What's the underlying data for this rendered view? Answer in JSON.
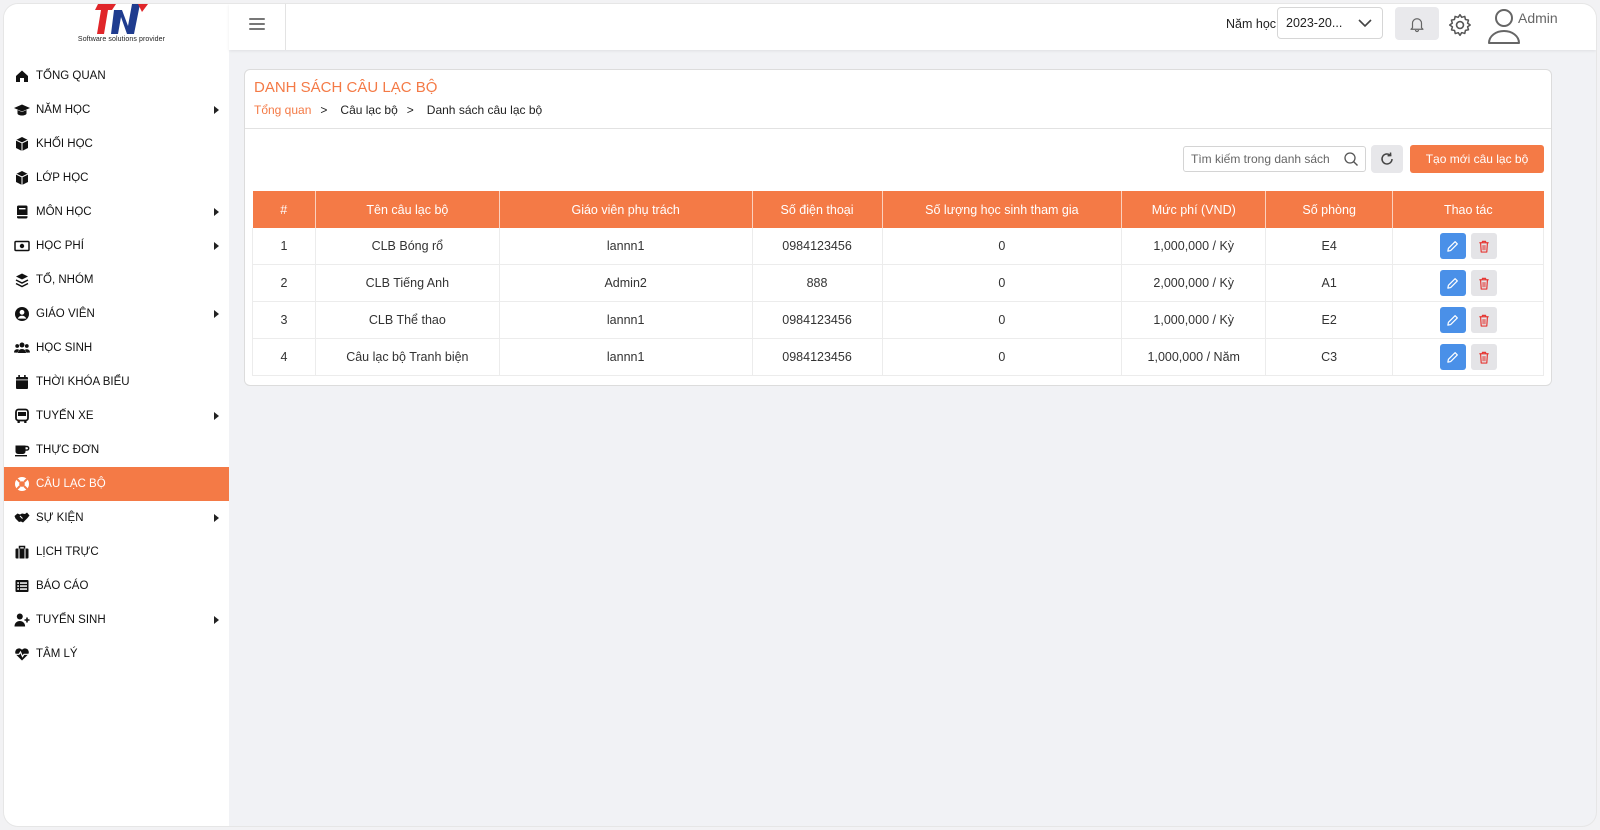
{
  "brand": {
    "tagline": "Software solutions provider"
  },
  "sidebar": {
    "items": [
      {
        "label": "Tổng quan",
        "icon": "home-icon",
        "has_submenu": false
      },
      {
        "label": "Năm học",
        "icon": "graduation-cap-icon",
        "has_submenu": true
      },
      {
        "label": "Khối học",
        "icon": "cube-icon",
        "has_submenu": false
      },
      {
        "label": "Lớp học",
        "icon": "cube-icon",
        "has_submenu": false
      },
      {
        "label": "Môn học",
        "icon": "book-icon",
        "has_submenu": true
      },
      {
        "label": "Học phí",
        "icon": "money-bill-icon",
        "has_submenu": true
      },
      {
        "label": "Tổ, nhóm",
        "icon": "layers-icon",
        "has_submenu": false
      },
      {
        "label": "Giáo viên",
        "icon": "user-circle-icon",
        "has_submenu": true
      },
      {
        "label": "Học sinh",
        "icon": "users-icon",
        "has_submenu": false
      },
      {
        "label": "Thời khóa biểu",
        "icon": "calendar-icon",
        "has_submenu": false
      },
      {
        "label": "Tuyến xe",
        "icon": "bus-icon",
        "has_submenu": true
      },
      {
        "label": "Thực đơn",
        "icon": "coffee-icon",
        "has_submenu": false
      },
      {
        "label": "Câu lạc bộ",
        "icon": "lifebuoy-icon",
        "has_submenu": false,
        "active": true
      },
      {
        "label": "Sự kiện",
        "icon": "handshake-icon",
        "has_submenu": true
      },
      {
        "label": "Lịch trực",
        "icon": "briefcase-icon",
        "has_submenu": false
      },
      {
        "label": "Báo cáo",
        "icon": "list-icon",
        "has_submenu": false
      },
      {
        "label": "Tuyển sinh",
        "icon": "user-plus-icon",
        "has_submenu": true
      },
      {
        "label": "Tâm lý",
        "icon": "heartbeat-icon",
        "has_submenu": false
      }
    ]
  },
  "topbar": {
    "year_label": "Năm học",
    "year_value": "2023-20...",
    "user_name": "Admin"
  },
  "page": {
    "title": "DANH SÁCH CÂU LẠC BỘ",
    "breadcrumb": {
      "home": "Tổng quan",
      "sep": ">",
      "level1": "Câu lạc bộ",
      "level2": "Danh sách câu lạc bộ"
    }
  },
  "toolbar": {
    "search_placeholder": "Tìm kiếm trong danh sách",
    "create_label": "Tạo mới câu lạc bộ"
  },
  "table": {
    "headers": [
      "#",
      "Tên câu lạc bộ",
      "Giáo viên phụ trách",
      "Số điện thoại",
      "Số lượng học sinh tham gia",
      "Mức phí (VND)",
      "Số phòng",
      "Thao tác"
    ],
    "rows": [
      [
        "1",
        "CLB Bóng rổ",
        "lannn1",
        "0984123456",
        "0",
        "1,000,000 / Kỳ",
        "E4"
      ],
      [
        "2",
        "CLB Tiếng Anh",
        "Admin2",
        "888",
        "0",
        "2,000,000 / Kỳ",
        "A1"
      ],
      [
        "3",
        "CLB Thể thao",
        "lannn1",
        "0984123456",
        "0",
        "1,000,000 / Kỳ",
        "E2"
      ],
      [
        "4",
        "Câu lạc bộ Tranh biện",
        "lannn1",
        "0984123456",
        "0",
        "1,000,000 / Năm",
        "C3"
      ]
    ]
  },
  "colors": {
    "accent": "#f47a46",
    "edit_button": "#4a90e8",
    "delete_icon": "#e53935",
    "logo_blue": "#1f3c8f",
    "logo_red": "#e0262a"
  }
}
